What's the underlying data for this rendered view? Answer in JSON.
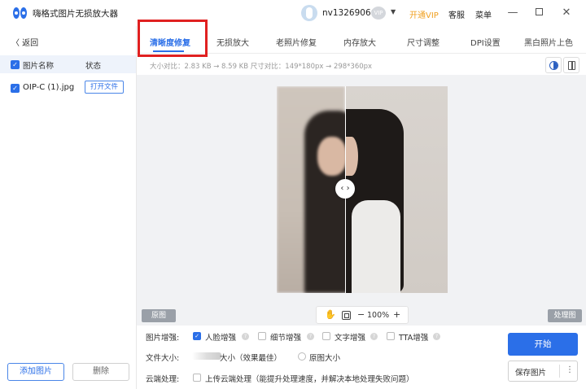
{
  "app": {
    "title": "嗨格式图片无损放大器",
    "username": "nv13269066",
    "vip_badge": "VIP",
    "open_vip": "开通VIP",
    "service": "客服",
    "menu": "菜单",
    "min_glyph": "—",
    "close_glyph": "✕",
    "caret": "▼"
  },
  "left_panel": {
    "back": "〈 返回",
    "col_name": "图片名称",
    "col_status": "状态",
    "files": [
      {
        "name": "OIP-C (1).jpg",
        "action": "打开文件",
        "checked": true
      }
    ],
    "add_button": "添加图片",
    "delete_button": "删除"
  },
  "tabs": [
    {
      "label": "清晰度修复",
      "active": true
    },
    {
      "label": "无损放大",
      "active": false
    },
    {
      "label": "老照片修复",
      "active": false
    },
    {
      "label": "内存放大",
      "active": false
    },
    {
      "label": "尺寸调整",
      "active": false
    },
    {
      "label": "DPI设置",
      "active": false
    },
    {
      "label": "黑白照片上色",
      "active": false
    }
  ],
  "info": {
    "size_compare": "大小对比：2.83 KB → 8.59 KB   尺寸对比：149*180px → 298*360px"
  },
  "canvas": {
    "original_label": "原图",
    "processed_label": "处理图",
    "handle_glyph": "‹ ›",
    "zoom": {
      "hand": "✋",
      "minus": "−",
      "value": "100%",
      "plus": "+"
    }
  },
  "options": {
    "enhance_label": "图片增强:",
    "enhance_items": [
      {
        "label": "人脸增强",
        "checked": true
      },
      {
        "label": "细节增强",
        "checked": false
      },
      {
        "label": "文字增强",
        "checked": false
      },
      {
        "label": "TTA增强",
        "checked": false
      }
    ],
    "filesize_label": "文件大小:",
    "filesize_best": "大小（效果最佳）",
    "filesize_original": "原图大小",
    "cloud_label": "云端处理:",
    "cloud_option": "上传云端处理（能提升处理速度，并解决本地处理失败问题）"
  },
  "actions": {
    "start": "开始",
    "save": "保存图片",
    "more": "⋮"
  },
  "colors": {
    "accent": "#2b6fe8",
    "vip": "#f0a020",
    "highlight": "#e02020"
  }
}
